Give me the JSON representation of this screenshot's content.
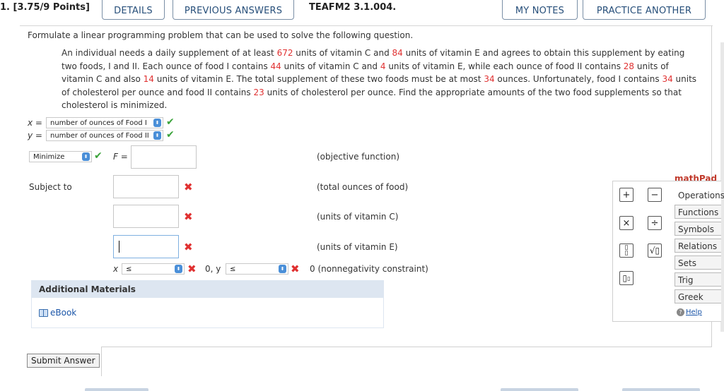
{
  "header": {
    "question_number": "1. [3.75/9 Points]",
    "details_label": "DETAILS",
    "previous_answers_label": "PREVIOUS ANSWERS",
    "code": "TEAFM2 3.1.004.",
    "my_notes_label": "MY NOTES",
    "practice_another_label": "PRACTICE ANOTHER"
  },
  "question": {
    "prompt": "Formulate a linear programming problem that can be used to solve the following question.",
    "text_parts": [
      {
        "t": "An individual needs a daily supplement of at least ",
        "hl": false
      },
      {
        "t": "672",
        "hl": true
      },
      {
        "t": " units of vitamin C and ",
        "hl": false
      },
      {
        "t": "84",
        "hl": true
      },
      {
        "t": " units of vitamin E and agrees to obtain this supplement by eating two foods, I and II. Each ounce of food I contains ",
        "hl": false
      },
      {
        "t": "44",
        "hl": true
      },
      {
        "t": " units of vitamin C and ",
        "hl": false
      },
      {
        "t": "4",
        "hl": true
      },
      {
        "t": " units of vitamin E, while each ounce of food II contains ",
        "hl": false
      },
      {
        "t": "28",
        "hl": true
      },
      {
        "t": " units of vitamin C and also ",
        "hl": false
      },
      {
        "t": "14",
        "hl": true
      },
      {
        "t": " units of vitamin E. The total supplement of these two foods must be at most ",
        "hl": false
      },
      {
        "t": "34",
        "hl": true
      },
      {
        "t": " ounces. Unfortunately, food I contains ",
        "hl": false
      },
      {
        "t": "34",
        "hl": true
      },
      {
        "t": " units of cholesterol per ounce and food II contains ",
        "hl": false
      },
      {
        "t": "23",
        "hl": true
      },
      {
        "t": " units of cholesterol per ounce. Find the appropriate amounts of the two food supplements so that cholesterol is minimized.",
        "hl": false
      }
    ]
  },
  "variables": {
    "x_label": "x =",
    "x_value": "number of ounces of Food I",
    "y_label": "y =",
    "y_value": "number of ounces of Food II"
  },
  "objective": {
    "mode": "Minimize",
    "f_label": "F =",
    "desc": "(objective function)"
  },
  "constraints": {
    "subject_to": "Subject to",
    "desc_total": "(total ounces of food)",
    "desc_vitc": "(units of vitamin C)",
    "desc_vite": "(units of vitamin E)",
    "x_label": "x",
    "x_op": "≤",
    "mid_text": "0, y",
    "y_op": "≤",
    "nonneg_desc": "0 (nonnegativity constraint)"
  },
  "additional": {
    "title": "Additional Materials",
    "ebook": "eBook"
  },
  "submit_label": "Submit Answer",
  "mathpad": {
    "title": "mathPad",
    "tabs": [
      "Operations",
      "Functions",
      "Symbols",
      "Relations",
      "Sets",
      "Trig",
      "Greek"
    ],
    "help": "Help"
  },
  "colors": {
    "highlight": "#e03131",
    "check": "#3aa33a",
    "link": "#1a55a8"
  }
}
